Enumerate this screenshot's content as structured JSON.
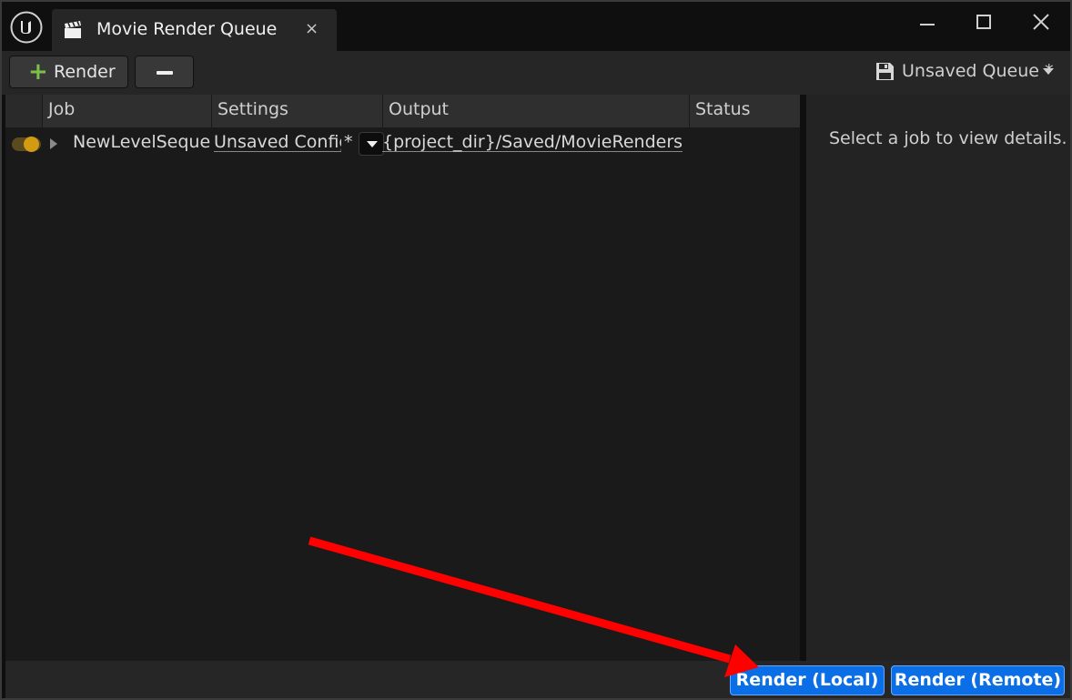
{
  "window": {
    "tab_title": "Movie Render Queue",
    "tab_close": "×",
    "icons": {
      "logo": "unreal-engine-logo-icon",
      "tab": "clapperboard-icon",
      "minimize": "minimize-icon",
      "maximize": "maximize-icon",
      "close": "close-icon"
    }
  },
  "toolbar": {
    "add_label": "Render",
    "add_icon": "plus-icon",
    "remove_icon": "minus-icon",
    "queue_label": "Unsaved Queue *",
    "queue_icon": "save-icon"
  },
  "table": {
    "columns": [
      "",
      "Job",
      "Settings",
      "Output",
      "Status"
    ],
    "rows": [
      {
        "enabled": true,
        "job": "NewLevelSequen",
        "settings": "Unsaved Config",
        "settings_modified": "*",
        "output": "{project_dir}/Saved/MovieRenders/",
        "status": ""
      }
    ]
  },
  "details": {
    "empty_text": "Select a job to view details."
  },
  "footer": {
    "render_local": "Render (Local)",
    "render_remote": "Render (Remote)"
  },
  "colors": {
    "accent_blue": "#0a6ee6",
    "toggle_on": "#d39a14",
    "add_green": "#7cc047",
    "annotation_red": "#ff0000"
  }
}
